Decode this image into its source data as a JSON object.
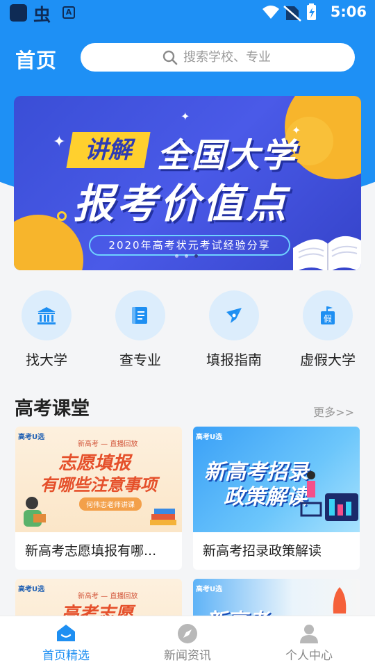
{
  "status_bar": {
    "time": "5:06"
  },
  "header": {
    "title": "首页"
  },
  "search": {
    "placeholder": "搜索学校、专业"
  },
  "banner": {
    "tag": "讲解",
    "line1": "全国大学",
    "line2": "报考价值点",
    "subtitle": "2020年高考状元考试经验分享",
    "page_count": 3,
    "active_page": 3
  },
  "quick_nav": [
    {
      "label": "找大学",
      "icon": "university-icon"
    },
    {
      "label": "查专业",
      "icon": "book-icon"
    },
    {
      "label": "填报指南",
      "icon": "compass-icon"
    },
    {
      "label": "虚假大学",
      "icon": "fake-school-icon"
    }
  ],
  "section": {
    "title": "高考课堂",
    "more": "更多>>"
  },
  "cards": [
    {
      "title": "新高考志愿填报有哪...",
      "thumb": {
        "brand": "高考U选",
        "small": "新高考 — 直播回放",
        "big1": "志愿填报",
        "big2": "有哪些注意事项",
        "pill": "何伟志老师讲课"
      }
    },
    {
      "title": "新高考招录政策解读",
      "thumb": {
        "brand": "高考U选",
        "big1": "新高考招录",
        "big2": "政策解读"
      }
    },
    {
      "title": "",
      "thumb": {
        "brand": "高考U选",
        "small": "新高考 — 直播回放",
        "big1": "高考志愿"
      }
    },
    {
      "title": "",
      "thumb": {
        "brand": "高考U选",
        "big1": "新高考"
      }
    }
  ],
  "tabs": [
    {
      "label": "首页精选",
      "icon": "home-icon",
      "active": true
    },
    {
      "label": "新闻资讯",
      "icon": "compass-icon",
      "active": false
    },
    {
      "label": "个人中心",
      "icon": "user-icon",
      "active": false
    }
  ],
  "colors": {
    "primary": "#1e90f5",
    "accent_yellow": "#ffd02e",
    "banner_blue": "#3a4ed6"
  }
}
